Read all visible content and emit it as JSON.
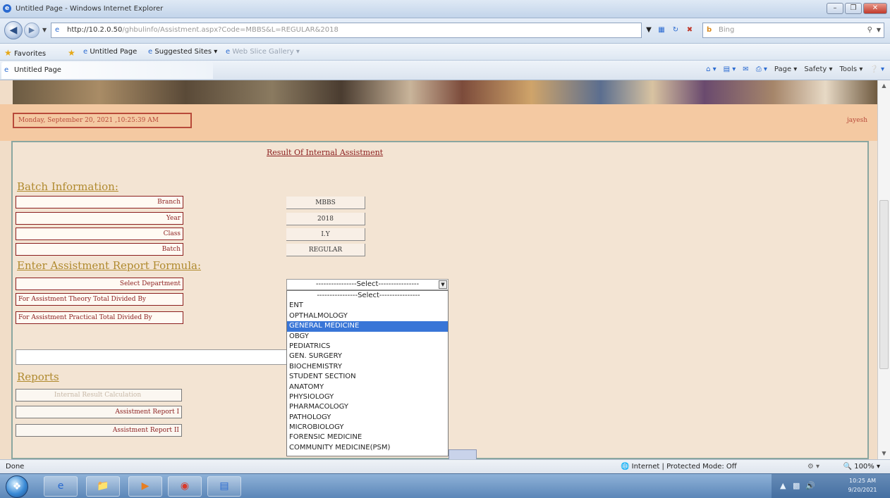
{
  "window": {
    "title": "Untitled Page - Windows Internet Explorer"
  },
  "address": {
    "url_host": "http://10.2.0.50",
    "url_path": "/ghbulinfo/Assistment.aspx?Code=MBBS&L=REGULAR&2018",
    "search_placeholder": "Bing"
  },
  "favorites": {
    "label": "Favorites",
    "items": [
      "Untitled Page",
      "Suggested Sites ▾",
      "Web Slice Gallery ▾"
    ]
  },
  "tab": {
    "label": "Untitled Page"
  },
  "command_bar": [
    "Page ▾",
    "Safety ▾",
    "Tools ▾"
  ],
  "page": {
    "date": "Monday, September 20, 2021 ,10:25:39 AM",
    "user": "jayesh",
    "result_title": "Result Of Internal Assistment",
    "batch_heading": "Batch Information:",
    "batch_rows": [
      {
        "label": "Branch",
        "value": "MBBS"
      },
      {
        "label": "Year",
        "value": "2018"
      },
      {
        "label": "Class",
        "value": "I.Y"
      },
      {
        "label": "Batch",
        "value": "REGULAR"
      }
    ],
    "formula_heading": "Enter Assistment Report Formula:",
    "formula_labels": {
      "dept": "Select Department",
      "theory": "For Assistment Theory Total Divided By",
      "practical": "For Assistment Practical Total Divided By"
    },
    "select": {
      "value": "----------------Select----------------",
      "options": [
        "----------------Select----------------",
        "ENT",
        "OPTHALMOLOGY",
        "GENERAL MEDICINE",
        "OBGY",
        "PEDIATRICS",
        "GEN. SURGERY",
        "BIOCHEMISTRY",
        "STUDENT SECTION",
        "ANATOMY",
        "PHYSIOLOGY",
        "PHARMACOLOGY",
        "PATHOLOGY",
        "MICROBIOLOGY",
        "FORENSIC MEDICINE",
        "COMMUNITY MEDICINE(PSM)"
      ],
      "selected_index": 3
    },
    "reports_heading": "Reports",
    "report_buttons": [
      "Internal Result Calculation",
      "Assistment Report I",
      "Assistment Report II"
    ]
  },
  "status": {
    "text": "Done",
    "zone": "Internet | Protected Mode: Off",
    "zoom": "100%"
  },
  "taskbar": {
    "time": "10:25 AM",
    "date": "9/20/2021"
  }
}
